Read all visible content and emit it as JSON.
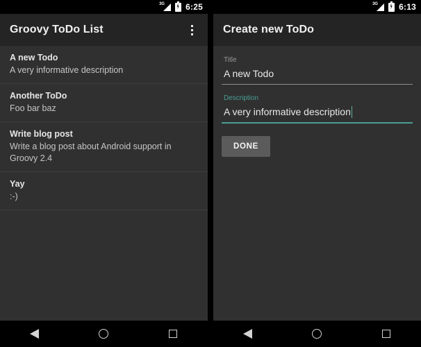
{
  "left_screen": {
    "statusbar": {
      "signal_icon": "signal-3g-icon",
      "signal_label": "3G",
      "battery_icon": "battery-charging-icon",
      "time": "6:25"
    },
    "appbar": {
      "title": "Groovy ToDo List",
      "overflow_icon": "overflow-menu-icon"
    },
    "todos": [
      {
        "title": "A new Todo",
        "description": "A very informative description"
      },
      {
        "title": "Another ToDo",
        "description": "Foo bar baz"
      },
      {
        "title": "Write blog post",
        "description": "Write a blog post about Android support in Groovy 2.4"
      },
      {
        "title": "Yay",
        "description": ":-)"
      }
    ],
    "navbar": {
      "back_label": "Back",
      "home_label": "Home",
      "recents_label": "Recents"
    }
  },
  "right_screen": {
    "statusbar": {
      "signal_icon": "signal-3g-icon",
      "signal_label": "3G",
      "battery_icon": "battery-charging-icon",
      "time": "6:13"
    },
    "appbar": {
      "title": "Create new ToDo"
    },
    "form": {
      "title_field": {
        "label": "Title",
        "value": "A new Todo",
        "focused": false
      },
      "description_field": {
        "label": "Description",
        "value": "A very informative description",
        "focused": true
      },
      "done_button": "DONE"
    },
    "navbar": {
      "back_label": "Back",
      "home_label": "Home",
      "recents_label": "Recents"
    }
  },
  "colors": {
    "accent": "#4b9e94",
    "appbar_bg": "#242424",
    "content_bg": "#303030",
    "statusbar_bg": "#000000",
    "button_bg": "#5b5b5b"
  }
}
